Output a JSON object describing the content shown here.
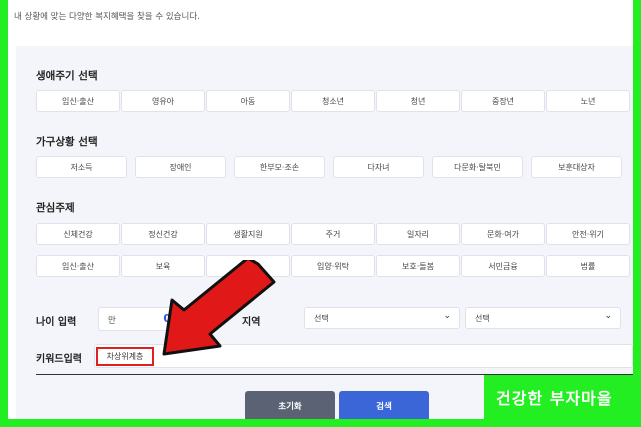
{
  "intro": "내 상황에 맞는 다양한 복지혜택을 찾을 수 있습니다.",
  "lifecycle": {
    "title": "생애주기 선택",
    "items": [
      "임신·출산",
      "영유아",
      "아동",
      "청소년",
      "청년",
      "중장년",
      "노년"
    ]
  },
  "household": {
    "title": "가구상황 선택",
    "items": [
      "저소득",
      "장애인",
      "한부모·조손",
      "다자녀",
      "다문화·탈북민",
      "보훈대상자"
    ]
  },
  "interest": {
    "title": "관심주제",
    "row1": [
      "신체건강",
      "정신건강",
      "생활지원",
      "주거",
      "일자리",
      "문화·여가",
      "안전·위기"
    ],
    "row2": [
      "임신·출산",
      "보육",
      "교육",
      "입양·위탁",
      "보호·돌봄",
      "서민금융",
      "법률"
    ]
  },
  "age": {
    "label": "나이 입력",
    "prefix": "만",
    "value": "0",
    "suffix": "세"
  },
  "region": {
    "label": "지역",
    "select1": "선택",
    "select2": "선택"
  },
  "keyword": {
    "label": "키워드입력",
    "value": "차상위계층"
  },
  "buttons": {
    "reset": "초기화",
    "search": "검색"
  },
  "brand": "건강한 부자마을",
  "colors": {
    "border": "#22ee22",
    "arrow": "#e01818",
    "search_button": "#3b66d8",
    "reset_button": "#5a6274",
    "age_value": "#2a56e0"
  }
}
